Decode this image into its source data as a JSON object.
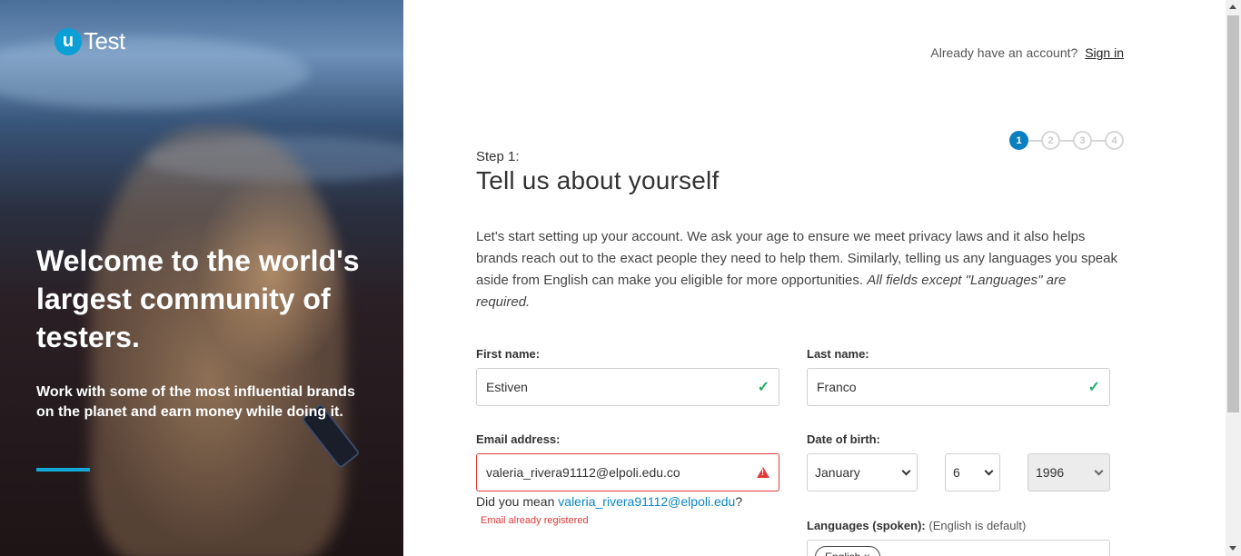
{
  "brand": {
    "badge": "u",
    "name": "Test",
    "accent": "#0aa0d6"
  },
  "hero": {
    "title": "Welcome to the world's largest community of testers.",
    "subtitle": "Work with some of the most influential brands on the planet and earn money while doing it."
  },
  "header": {
    "already_text": "Already have an account?",
    "signin_label": "Sign in"
  },
  "stepper": {
    "steps": [
      "1",
      "2",
      "3",
      "4"
    ],
    "active": 1,
    "active_color": "#0a7fc0"
  },
  "step": {
    "label": "Step 1:",
    "title": "Tell us about yourself",
    "intro": "Let's start setting up your account. We ask your age to ensure we meet privacy laws and it also helps brands reach out to the exact people they need to help them. Similarly, telling us any languages you speak aside from English can make you eligible for more opportunities.",
    "intro_emphasis": "All fields except \"Languages\" are required."
  },
  "form": {
    "first_name": {
      "label": "First name:",
      "value": "Estiven",
      "status": "valid"
    },
    "last_name": {
      "label": "Last name:",
      "value": "Franco",
      "status": "valid"
    },
    "email": {
      "label": "Email address:",
      "value": "valeria_rivera91112@elpoli.edu.co",
      "status": "error",
      "suggest_prefix": "Did you mean",
      "suggestion": "valeria_rivera91112@elpoli.edu",
      "suggest_suffix": "?",
      "error_message": "Email already registered"
    },
    "dob": {
      "label": "Date of birth:",
      "month": "January",
      "day": "6",
      "year": "1996"
    },
    "languages": {
      "label": "Languages (spoken):",
      "note": "(English is default)",
      "chip": "English ×"
    }
  }
}
